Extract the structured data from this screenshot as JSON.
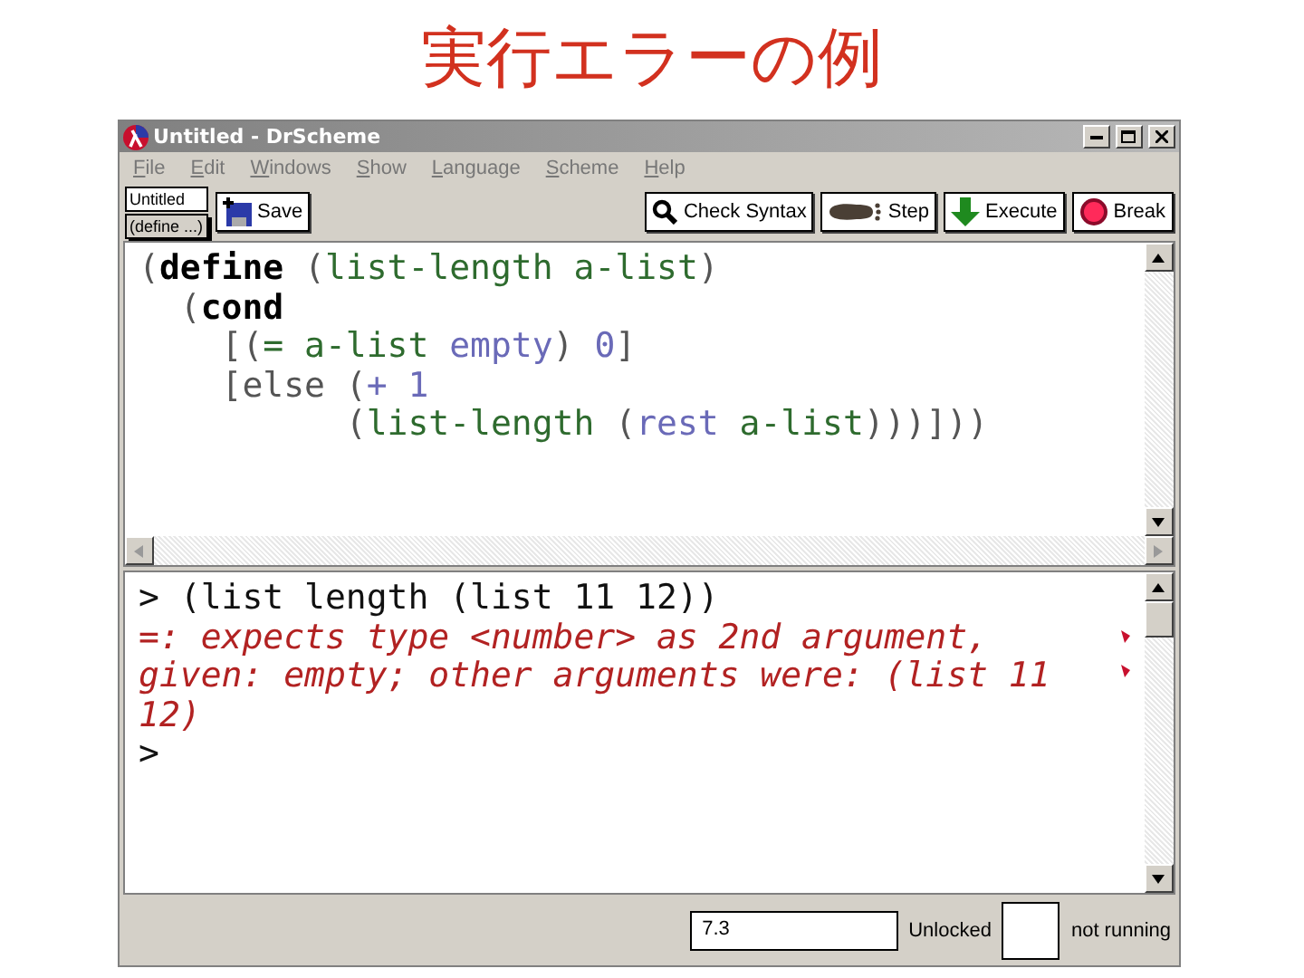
{
  "slide_title": "実行エラーの例",
  "window": {
    "title": "Untitled - DrScheme"
  },
  "menu": [
    "File",
    "Edit",
    "Windows",
    "Show",
    "Language",
    "Scheme",
    "Help"
  ],
  "tabs": [
    {
      "label": "Untitled",
      "selected": true
    },
    {
      "label": "(define ...)",
      "selected": false
    }
  ],
  "toolbar": {
    "save": "Save",
    "buttons": [
      {
        "kind": "check",
        "label": "Check Syntax"
      },
      {
        "kind": "step",
        "label": "Step"
      },
      {
        "kind": "execute",
        "label": "Execute"
      },
      {
        "kind": "break",
        "label": "Break"
      }
    ]
  },
  "definitions": [
    [
      {
        "text": "(",
        "kind": "paren"
      },
      {
        "text": "define",
        "kind": "keyword"
      },
      {
        "text": " (",
        "kind": "paren"
      },
      {
        "text": "list-length a-list",
        "kind": "ident"
      },
      {
        "text": ")",
        "kind": "paren"
      }
    ],
    [
      {
        "text": "  (",
        "kind": "paren"
      },
      {
        "text": "cond",
        "kind": "keyword"
      }
    ],
    [
      {
        "text": "    [(",
        "kind": "paren"
      },
      {
        "text": "= a-list ",
        "kind": "ident"
      },
      {
        "text": "empty",
        "kind": "constant"
      },
      {
        "text": ") ",
        "kind": "paren"
      },
      {
        "text": "0",
        "kind": "constant"
      },
      {
        "text": "]",
        "kind": "paren"
      }
    ],
    [
      {
        "text": "    [else (",
        "kind": "paren"
      },
      {
        "text": "+ 1",
        "kind": "constant"
      }
    ],
    [
      {
        "text": "          (",
        "kind": "paren"
      },
      {
        "text": "list-length",
        "kind": "ident"
      },
      {
        "text": " (",
        "kind": "paren"
      },
      {
        "text": "rest",
        "kind": "constant"
      },
      {
        "text": " a-list",
        "kind": "ident"
      },
      {
        "text": ")))]))",
        "kind": "paren"
      }
    ]
  ],
  "interactions": [
    {
      "kind": "input",
      "prompt": ">",
      "text": "(list length (list 11 12))"
    },
    {
      "kind": "error",
      "text": "=: expects type <number> as 2nd argument, given: empty; other arguments were: (list 11 12)"
    },
    {
      "kind": "input",
      "prompt": ">"
    }
  ],
  "status_bar": {
    "field": "7.3",
    "lock": "Unlocked",
    "state": "not running"
  }
}
